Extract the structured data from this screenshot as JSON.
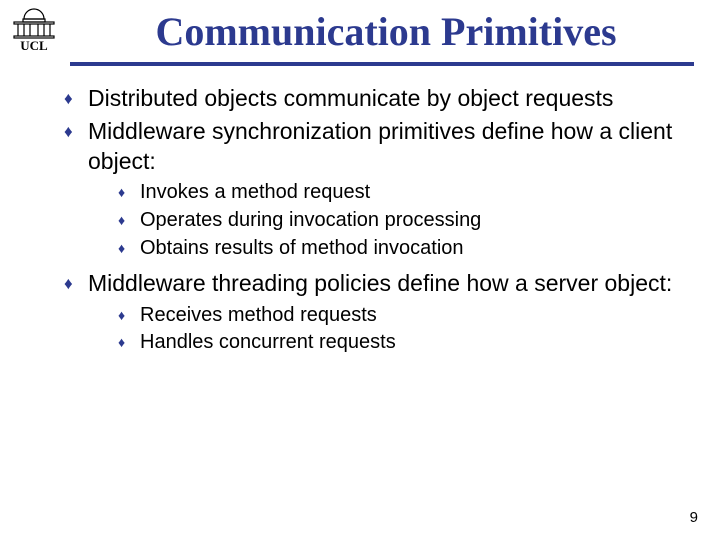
{
  "title": "Communication Primitives",
  "logo_text": "UCL",
  "bullets": {
    "b1": "Distributed objects communicate by object requests",
    "b2": "Middleware synchronization primitives define how a client object:",
    "b2_subs": {
      "s1": "Invokes a method request",
      "s2": "Operates during invocation processing",
      "s3": "Obtains results of method invocation"
    },
    "b3": "Middleware threading policies define how a server object:",
    "b3_subs": {
      "s1": "Receives method requests",
      "s2": "Handles concurrent requests"
    }
  },
  "page_number": "9"
}
